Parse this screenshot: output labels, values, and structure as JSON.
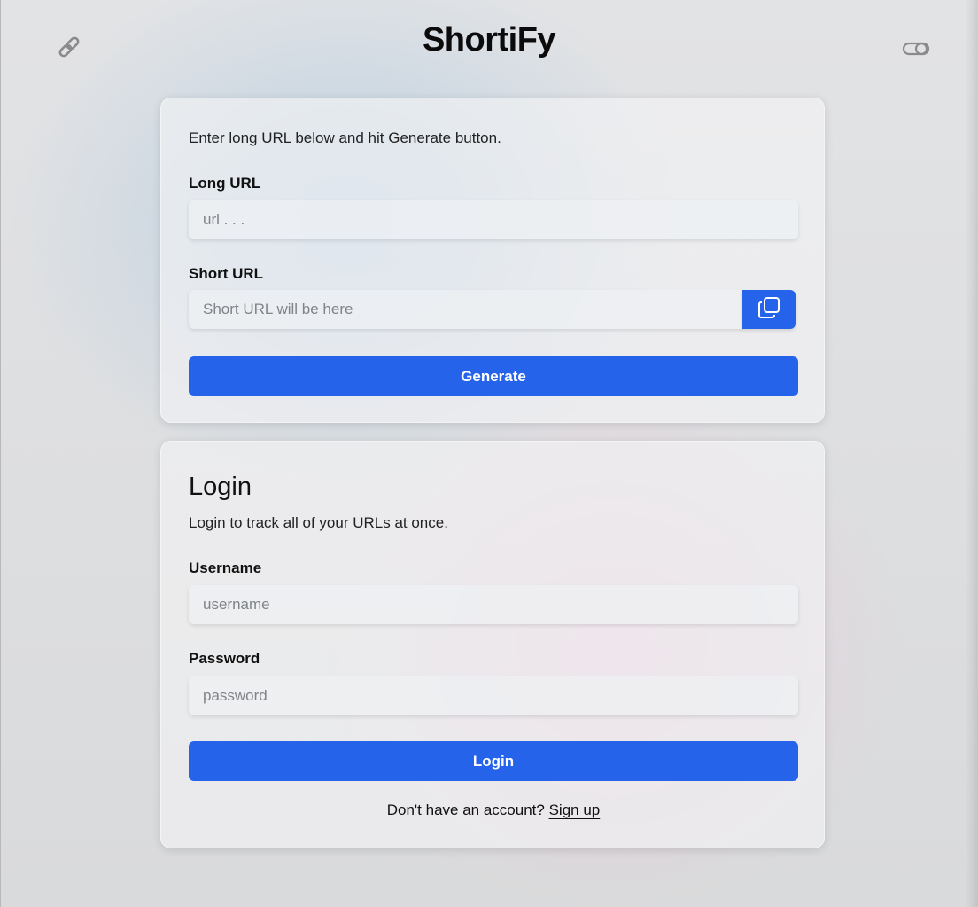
{
  "header": {
    "title": "ShortiFy",
    "left_icon": "link-icon",
    "right_icon": "theme-toggle-icon"
  },
  "shortener": {
    "description": "Enter long URL below and hit Generate button.",
    "long_url_label": "Long URL",
    "long_url_placeholder": "url . . .",
    "long_url_value": "",
    "short_url_label": "Short URL",
    "short_url_placeholder": "Short URL will be here",
    "short_url_value": "",
    "copy_icon": "copy-icon",
    "generate_label": "Generate"
  },
  "login": {
    "title": "Login",
    "description": "Login to track all of your URLs at once.",
    "username_label": "Username",
    "username_placeholder": "username",
    "username_value": "",
    "password_label": "Password",
    "password_placeholder": "password",
    "password_value": "",
    "submit_label": "Login",
    "signup_prompt": "Don't have an account?",
    "signup_link": "Sign up"
  },
  "colors": {
    "accent": "#2563eb",
    "text": "#111111"
  }
}
